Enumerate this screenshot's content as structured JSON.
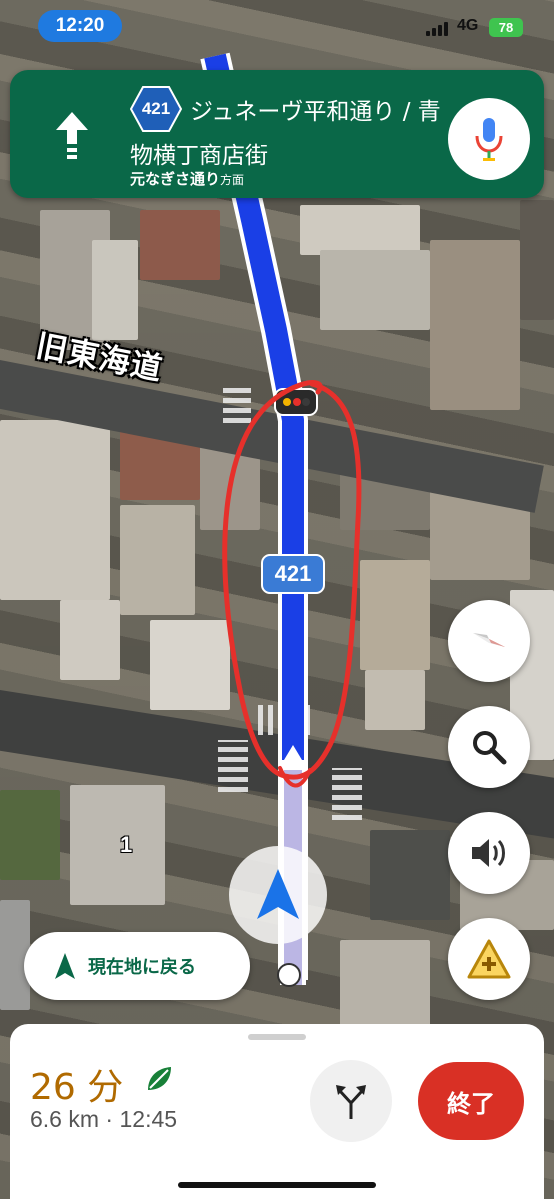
{
  "status_bar": {
    "time": "12:20",
    "network": "4G",
    "battery": "78"
  },
  "navigation": {
    "maneuver_icon": "straight-arrow-icon",
    "route_number": "421",
    "street_line1": "ジュネーヴ平和通り / 青",
    "street_line2": "物横丁商店街",
    "toward_name": "元なぎさ通り",
    "toward_suffix": "方面",
    "mic_icon": "microphone-icon"
  },
  "map": {
    "road_label": "旧東海道",
    "route_shield": "421",
    "block_number": "1",
    "route_color": "#1a3fe6",
    "annotation_color": "#e6302b"
  },
  "controls": {
    "compass_icon": "compass-icon",
    "search_icon": "search-icon",
    "sound_icon": "speaker-icon",
    "report_icon": "report-incident-icon",
    "recenter_label": "現在地に戻る"
  },
  "trip": {
    "eta_minutes": "26 分",
    "distance": "6.6 km",
    "arrival_time": "12:45",
    "eco_icon": "leaf-icon",
    "alt_routes_icon": "alternate-routes-icon",
    "exit_label": "終了"
  }
}
